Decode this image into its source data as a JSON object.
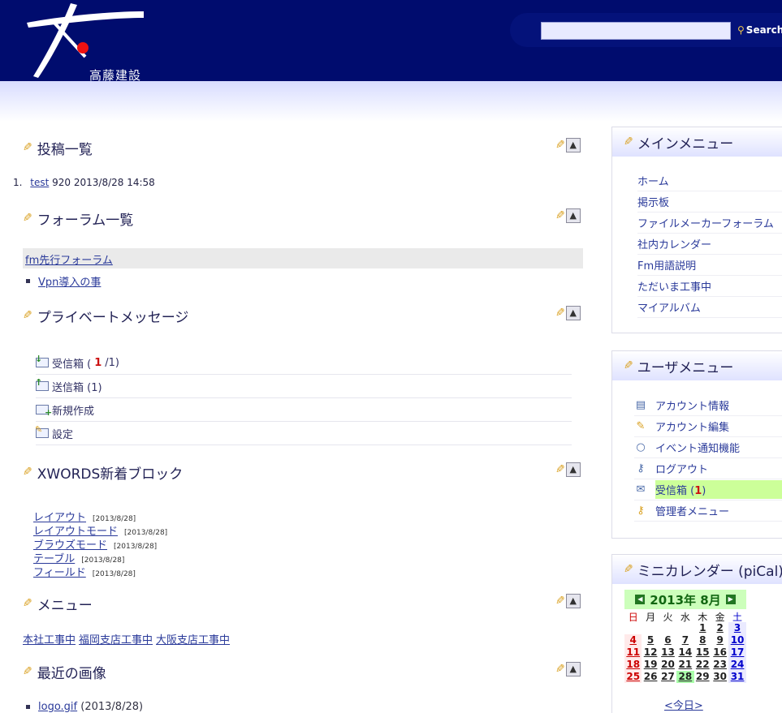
{
  "header": {
    "logo_text": "高藤建設",
    "search_placeholder": "",
    "search_label": "Search"
  },
  "main": {
    "posts": {
      "title": "投稿一覧",
      "items": [
        {
          "num": "1.",
          "link": "test",
          "rest": "920 2013/8/28 14:58"
        }
      ]
    },
    "forums": {
      "title": "フォーラム一覧",
      "category": "fm先行フォーラム",
      "items": [
        "Vpn導入の事"
      ]
    },
    "pm": {
      "title": "プライベートメッセージ",
      "inbox_label": "受信箱 (",
      "inbox_unread": "1",
      "inbox_rest": "/1)",
      "outbox": "送信箱 (1)",
      "compose": "新規作成",
      "settings": "設定"
    },
    "xwords": {
      "title": "XWORDS新着ブロック",
      "items": [
        {
          "term": "レイアウト",
          "date": "[2013/8/28]"
        },
        {
          "term": "レイアウトモード",
          "date": "[2013/8/28]"
        },
        {
          "term": "ブラウズモード",
          "date": "[2013/8/28]"
        },
        {
          "term": "テーブル",
          "date": "[2013/8/28]"
        },
        {
          "term": "フィールド",
          "date": "[2013/8/28]"
        }
      ]
    },
    "menu": {
      "title": "メニュー",
      "links": [
        "本社工事中",
        "福岡支店工事中",
        "大阪支店工事中"
      ]
    },
    "images": {
      "title": "最近の画像",
      "items": [
        {
          "link": "logo.gif",
          "rest": "(2013/8/28)"
        }
      ]
    }
  },
  "sidebar": {
    "main_menu": {
      "title": "メインメニュー",
      "items": [
        "ホーム",
        "掲示板",
        "ファイルメーカーフォーラム",
        "社内カレンダー",
        "Fm用語説明",
        "ただいま工事中",
        "マイアルバム"
      ]
    },
    "user_menu": {
      "title": "ユーザメニュー",
      "items": [
        {
          "label": "アカウント情報",
          "icon": "id-card-icon"
        },
        {
          "label": "アカウント編集",
          "icon": "edit-account-icon"
        },
        {
          "label": "イベント通知機能",
          "icon": "chat-bubble-icon"
        },
        {
          "label": "ログアウト",
          "icon": "key-icon"
        },
        {
          "label": "受信箱 (",
          "unread": "1",
          "close": ")",
          "icon": "envelope-icon"
        },
        {
          "label": "管理者メニュー",
          "icon": "admin-key-icon"
        }
      ]
    },
    "calendar": {
      "title": "ミニカレンダー (piCal)",
      "month": "2013年 8月",
      "weekdays": [
        "日",
        "月",
        "火",
        "水",
        "木",
        "金",
        "土"
      ],
      "weeks": [
        [
          "",
          "",
          "",
          "",
          "1",
          "2",
          "3"
        ],
        [
          "4",
          "5",
          "6",
          "7",
          "8",
          "9",
          "10"
        ],
        [
          "11",
          "12",
          "13",
          "14",
          "15",
          "16",
          "17"
        ],
        [
          "18",
          "19",
          "20",
          "21",
          "22",
          "23",
          "24"
        ],
        [
          "25",
          "26",
          "27",
          "28",
          "29",
          "30",
          "31"
        ]
      ],
      "today": "28",
      "today_label": "<今日>"
    }
  },
  "colors": {
    "header_bg": "#000c6e",
    "link": "#2a3a9a",
    "highlight": "#ccff99",
    "calendar_header": "#ccffbb"
  }
}
